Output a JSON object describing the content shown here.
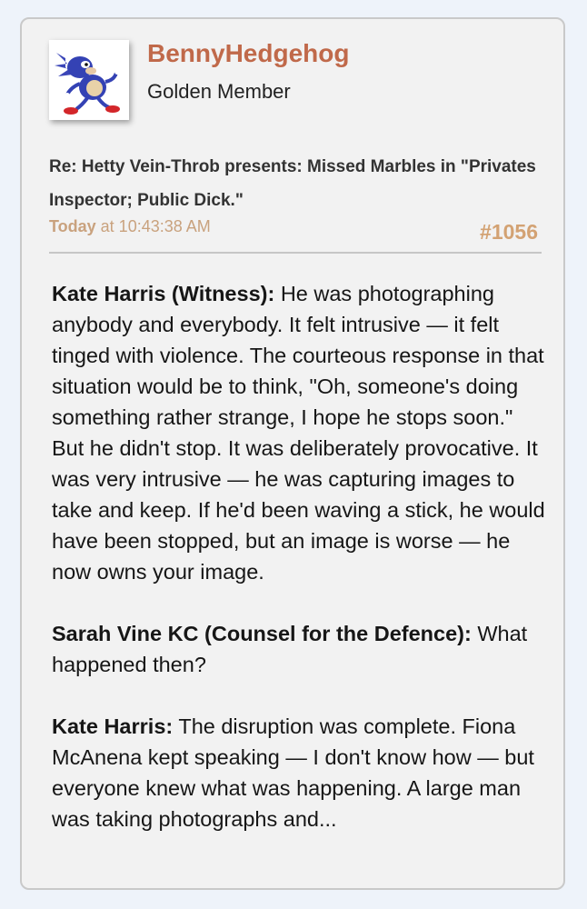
{
  "post": {
    "author": "BennyHedgehog",
    "member_title": "Golden Member",
    "thread_title": "Re: Hetty Vein-Throb presents: Missed Marbles in \"Privates Inspector; Public Dick.\"",
    "date_day": "Today",
    "date_time": " at 10:43:38 AM",
    "post_number": "#1056",
    "avatar_icon": "cartoon-hedgehog-avatar",
    "paragraphs": [
      {
        "speaker": "Kate Harris (Witness):",
        "text": " He was photographing anybody and everybody. It felt intrusive — it felt tinged with violence. The courteous response in that situation would be to think, \"Oh, someone's doing something rather strange, I hope he stops soon.\" But he didn't stop. It was deliberately provocative. It was very intrusive — he was capturing images to take and keep. If he'd been waving a stick, he would have been stopped, but an image is worse — he now owns your image."
      },
      {
        "speaker": "Sarah Vine KC (Counsel for the Defence):",
        "text": " What happened then?"
      },
      {
        "speaker": "Kate Harris:",
        "text": " The disruption was complete. Fiona McAnena kept speaking — I don't know how — but everyone knew what was happening. A large man was taking photographs and..."
      }
    ]
  },
  "colors": {
    "username": "#c0694a",
    "meta": "#c9a27e",
    "post_number": "#d3a273",
    "card_bg": "#f2f2f2",
    "page_bg": "#eef3fa"
  }
}
